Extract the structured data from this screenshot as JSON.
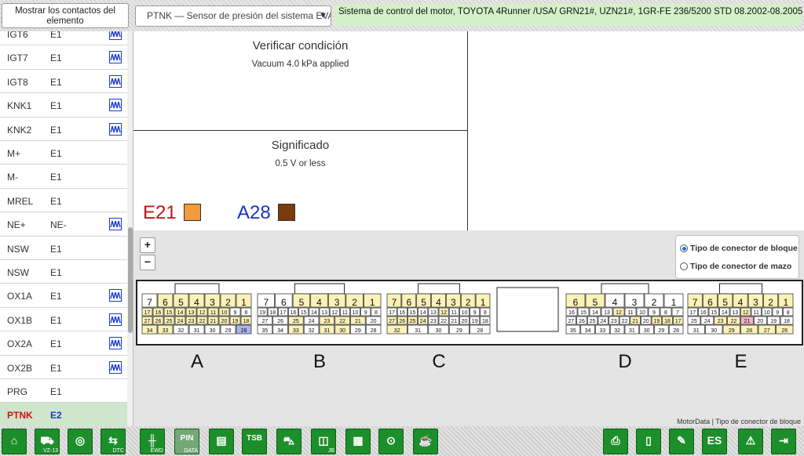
{
  "header": {
    "contacts_button": "Mostrar los contactos del elemento",
    "sensor_select": "PTNK — Sensor de presión del sistema EVAP",
    "system_info": "Sistema de control del motor, TOYOTA 4Runner /USA/ GRN21#, UZN21#, 1GR-FE 236/5200 STD 08.2002-08.2005"
  },
  "pin_list": [
    {
      "a": "IGT6",
      "b": "E1",
      "wave": true
    },
    {
      "a": "IGT7",
      "b": "E1",
      "wave": true
    },
    {
      "a": "IGT8",
      "b": "E1",
      "wave": true
    },
    {
      "a": "KNK1",
      "b": "E1",
      "wave": true
    },
    {
      "a": "KNK2",
      "b": "E1",
      "wave": true
    },
    {
      "a": "M+",
      "b": "E1",
      "wave": false
    },
    {
      "a": "M-",
      "b": "E1",
      "wave": false
    },
    {
      "a": "MREL",
      "b": "E1",
      "wave": false
    },
    {
      "a": "NE+",
      "b": "NE-",
      "wave": true
    },
    {
      "a": "NSW",
      "b": "E1",
      "wave": false
    },
    {
      "a": "NSW",
      "b": "E1",
      "wave": false
    },
    {
      "a": "OX1A",
      "b": "E1",
      "wave": true
    },
    {
      "a": "OX1B",
      "b": "E1",
      "wave": true
    },
    {
      "a": "OX2A",
      "b": "E1",
      "wave": true
    },
    {
      "a": "OX2B",
      "b": "E1",
      "wave": true
    },
    {
      "a": "PRG",
      "b": "E1",
      "wave": false
    },
    {
      "a": "PTNK",
      "b": "E2",
      "wave": false,
      "selected": true
    }
  ],
  "condition": {
    "title": "Verificar condición",
    "text": "Vacuum 4.0 kPa applied"
  },
  "meaning": {
    "title": "Significado",
    "text": "0.5 V or less"
  },
  "pins": [
    {
      "label": "E21",
      "color": "#c0131b",
      "swatch": "#f39a3a"
    },
    {
      "label": "A28",
      "color": "#1a33c4",
      "swatch": "#7a3a0a"
    }
  ],
  "zoom": {
    "in": "+",
    "out": "−"
  },
  "connector_type": {
    "block": "Tipo de conector de bloque",
    "harness": "Tipo de conector de mazo",
    "selected": "block"
  },
  "connectors": [
    {
      "letter": "A",
      "top": [
        "7",
        "6",
        "5",
        "4",
        "3",
        "2",
        "1"
      ],
      "mid": [
        "17",
        "16",
        "15",
        "14",
        "13",
        "12",
        "11",
        "10",
        "9",
        "8"
      ],
      "mid2": [
        "27",
        "26",
        "25",
        "24",
        "23",
        "22",
        "21",
        "20",
        "19",
        "18"
      ],
      "bot": [
        "34",
        "33",
        "32",
        "31",
        "30",
        "29",
        "28"
      ]
    },
    {
      "letter": "B",
      "top": [
        "7",
        "6",
        "5",
        "4",
        "3",
        "2",
        "1"
      ],
      "mid": [
        "19",
        "18",
        "17",
        "16",
        "15",
        "14",
        "13",
        "12",
        "11",
        "10",
        "9",
        "8"
      ],
      "mid2": [
        "27",
        "26",
        "25",
        "24",
        "23",
        "22",
        "21",
        "20"
      ],
      "bot": [
        "35",
        "34",
        "33",
        "32",
        "31",
        "30",
        "29",
        "28"
      ]
    },
    {
      "letter": "C",
      "top": [
        "7",
        "6",
        "5",
        "4",
        "3",
        "2",
        "1"
      ],
      "mid": [
        "17",
        "16",
        "15",
        "14",
        "13",
        "12",
        "11",
        "10",
        "9",
        "8"
      ],
      "mid2": [
        "27",
        "26",
        "25",
        "24",
        "23",
        "22",
        "21",
        "20",
        "19",
        "18"
      ],
      "bot": [
        "32",
        "31",
        "30",
        "29",
        "28"
      ]
    },
    {
      "letter": "D",
      "top": [
        "6",
        "5",
        "4",
        "3",
        "2",
        "1"
      ],
      "mid": [
        "16",
        "15",
        "14",
        "13",
        "12",
        "11",
        "10",
        "9",
        "8",
        "7"
      ],
      "mid2": [
        "27",
        "26",
        "25",
        "24",
        "23",
        "22",
        "21",
        "20",
        "19",
        "18",
        "17"
      ],
      "bot": [
        "35",
        "34",
        "33",
        "32",
        "31",
        "30",
        "29",
        "28"
      ]
    },
    {
      "letter": "E",
      "top": [
        "7",
        "6",
        "5",
        "4",
        "3",
        "2",
        "1"
      ],
      "mid": [
        "17",
        "16",
        "15",
        "14",
        "13",
        "12",
        "11",
        "10",
        "9",
        "8"
      ],
      "mid2": [
        "25",
        "24",
        "23",
        "22",
        "21",
        "20",
        "19",
        "18"
      ],
      "bot": [
        "31",
        "30",
        "29",
        "28",
        "27",
        "26"
      ]
    }
  ],
  "credit": "MotorData | Tipo de conector de bloque",
  "toolbar": [
    {
      "name": "home",
      "glyph": "⌂",
      "sub": ""
    },
    {
      "name": "vehicle",
      "glyph": "⛟",
      "sub": "VZ-13"
    },
    {
      "name": "wheel",
      "glyph": "◎",
      "sub": ""
    },
    {
      "name": "dtc",
      "glyph": "⇆",
      "sub": "DTC"
    },
    {
      "name": "ewd",
      "glyph": "╫",
      "sub": "EWD"
    },
    {
      "name": "pin-data",
      "glyph": "PIN",
      "sub": "DATA",
      "disabled": true
    },
    {
      "name": "procedure",
      "glyph": "▤",
      "sub": ""
    },
    {
      "name": "tsb",
      "glyph": "TSB",
      "sub": ""
    },
    {
      "name": "lift",
      "glyph": "⛍",
      "sub": ""
    },
    {
      "name": "jb",
      "glyph": "◫",
      "sub": "JB"
    },
    {
      "name": "connector",
      "glyph": "▦",
      "sub": ""
    },
    {
      "name": "warning-light",
      "glyph": "⊙",
      "sub": ""
    },
    {
      "name": "oil",
      "glyph": "☕",
      "sub": ""
    },
    {
      "name": "print",
      "glyph": "⎙",
      "sub": ""
    },
    {
      "name": "book",
      "glyph": "▯",
      "sub": ""
    },
    {
      "name": "tip",
      "glyph": "✎",
      "sub": ""
    },
    {
      "name": "language",
      "glyph": "ES",
      "sub": ""
    },
    {
      "name": "alert",
      "glyph": "⚠",
      "sub": ""
    },
    {
      "name": "exit",
      "glyph": "⇥",
      "sub": ""
    }
  ]
}
